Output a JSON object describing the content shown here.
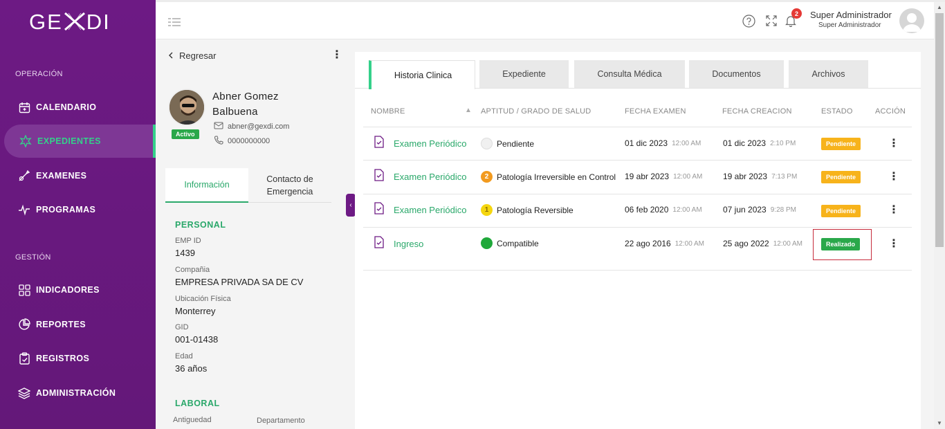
{
  "sidebar": {
    "logo": "GEXDI",
    "sections": [
      {
        "label": "OPERACIÓN"
      },
      {
        "label": "GESTIÓN"
      }
    ],
    "items": [
      {
        "label": "CALENDARIO",
        "icon": "calendar-icon"
      },
      {
        "label": "EXPEDIENTES",
        "icon": "cross-star-icon"
      },
      {
        "label": "EXAMENES",
        "icon": "tools-icon"
      },
      {
        "label": "PROGRAMAS",
        "icon": "pulse-icon"
      },
      {
        "label": "INDICADORES",
        "icon": "grid-icon"
      },
      {
        "label": "REPORTES",
        "icon": "pie-icon"
      },
      {
        "label": "REGISTROS",
        "icon": "clipboard-icon"
      },
      {
        "label": "ADMINISTRACIÓN",
        "icon": "layers-icon"
      }
    ]
  },
  "header": {
    "notifications": "2",
    "user_name": "Super Administrador",
    "user_role": "Super Administrador"
  },
  "patient": {
    "back_label": "Regresar",
    "name": "Abner Gomez Balbuena",
    "status": "Activo",
    "email": "abner@gexdi.com",
    "phone": "0000000000",
    "tabs": [
      {
        "label": "Información"
      },
      {
        "label": "Contacto de Emergencia"
      }
    ],
    "personal_title": "PERSONAL",
    "fields": [
      {
        "label": "EMP ID",
        "value": "1439"
      },
      {
        "label": "Compañia",
        "value": "EMPRESA PRIVADA SA DE CV"
      },
      {
        "label": "Ubicación Física",
        "value": "Monterrey"
      },
      {
        "label": "GID",
        "value": "001-01438"
      },
      {
        "label": "Edad",
        "value": "36 años"
      }
    ],
    "laboral_title": "LABORAL",
    "laboral_fields": [
      {
        "label": "Antiguedad"
      },
      {
        "label": "Departamento"
      }
    ]
  },
  "tabs": [
    {
      "label": "Historia Clinica"
    },
    {
      "label": "Expediente"
    },
    {
      "label": "Consulta Médica"
    },
    {
      "label": "Documentos"
    },
    {
      "label": "Archivos"
    }
  ],
  "table": {
    "headers": [
      "NOMBRE",
      "APTITUD / GRADO DE SALUD",
      "FECHA EXAMEN",
      "FECHA CREACION",
      "ESTADO",
      "ACCIÓN"
    ],
    "rows": [
      {
        "name": "Examen Periódico",
        "aptitud": "Pendiente",
        "aptitud_num": "",
        "aptitud_color": "#f0f0f0",
        "fecha_examen": "01 dic 2023",
        "hora_examen": "12:00 AM",
        "fecha_creacion": "01 dic 2023",
        "hora_creacion": "2:10 PM",
        "estado": "Pendiente"
      },
      {
        "name": "Examen Periódico",
        "aptitud": "Patología Irreversible en Control",
        "aptitud_num": "2",
        "aptitud_color": "#f29a1e",
        "fecha_examen": "19 abr 2023",
        "hora_examen": "12:00 AM",
        "fecha_creacion": "19 abr 2023",
        "hora_creacion": "7:13 PM",
        "estado": "Pendiente"
      },
      {
        "name": "Examen Periódico",
        "aptitud": "Patología Reversible",
        "aptitud_num": "1",
        "aptitud_color": "#f5d60f",
        "fecha_examen": "06 feb 2020",
        "hora_examen": "12:00 AM",
        "fecha_creacion": "07 jun 2023",
        "hora_creacion": "9:28 PM",
        "estado": "Pendiente"
      },
      {
        "name": "Ingreso",
        "aptitud": "Compatible",
        "aptitud_num": "",
        "aptitud_color": "#1fa83a",
        "fecha_examen": "22 ago 2016",
        "hora_examen": "12:00 AM",
        "fecha_creacion": "25 ago 2022",
        "hora_creacion": "12:00 AM",
        "estado": "Realizado"
      }
    ]
  },
  "colors": {
    "sidebar": "#6d1a84",
    "accent_green": "#2aa86a",
    "pending": "#f7b31b",
    "done": "#2aa84a"
  }
}
